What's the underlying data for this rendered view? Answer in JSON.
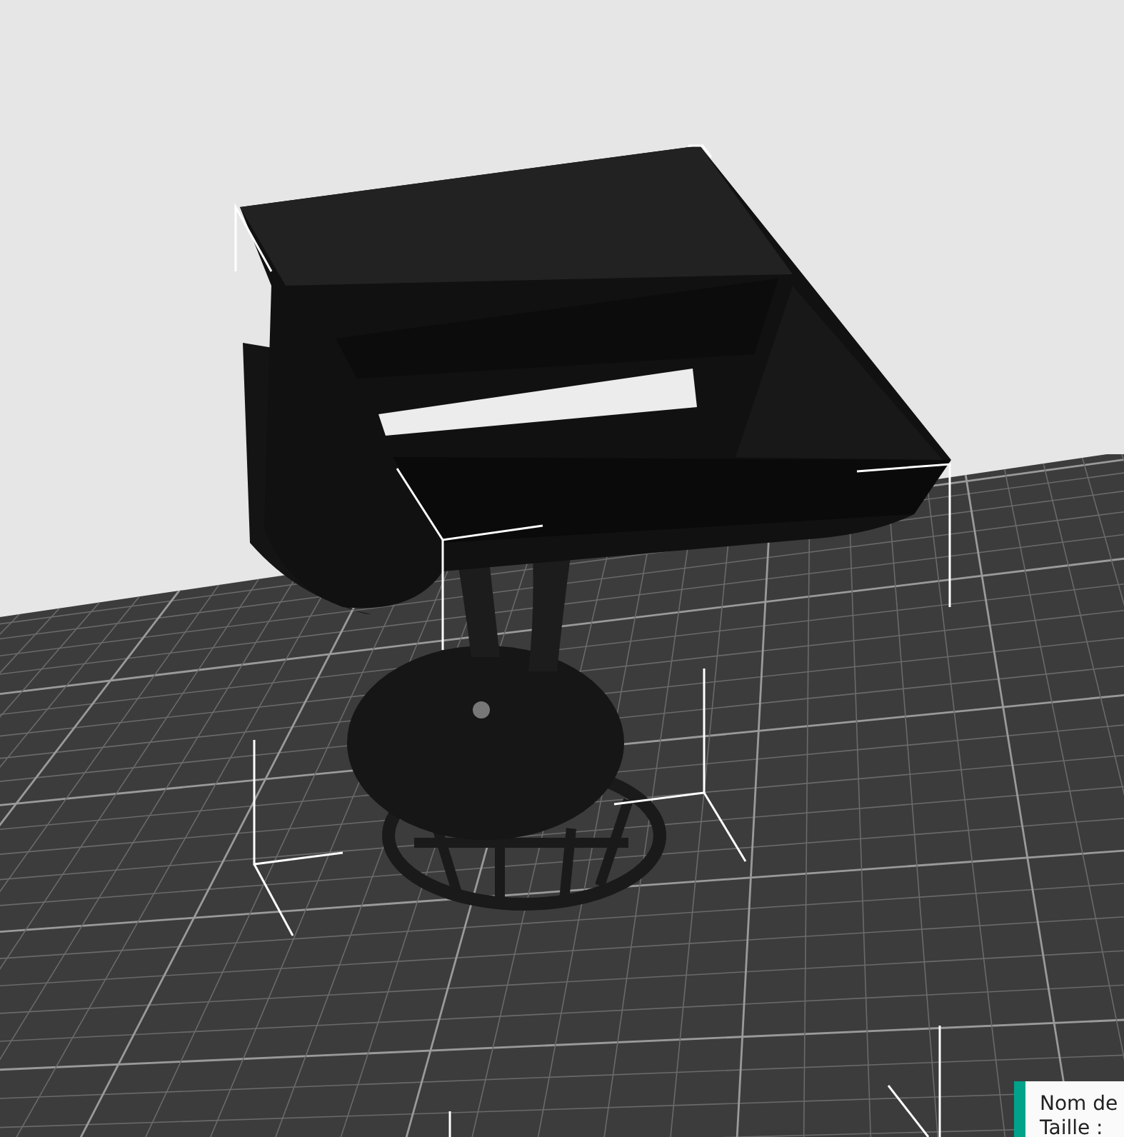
{
  "viewport": {
    "tooltip": {
      "lines": [
        "Nom de",
        "Taille :"
      ]
    }
  }
}
